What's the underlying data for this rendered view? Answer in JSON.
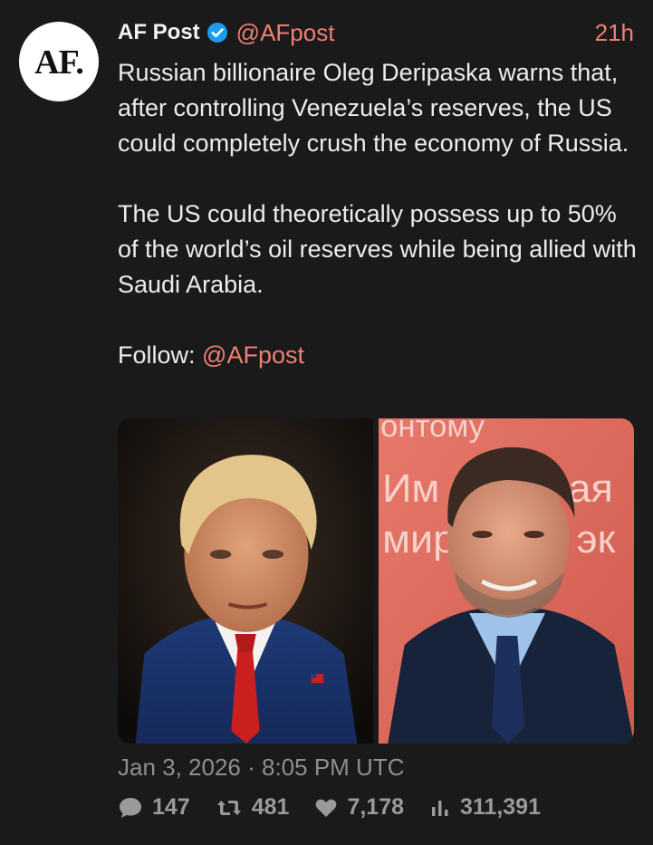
{
  "author": {
    "avatar_text": "AF.",
    "name": "AF Post",
    "handle": "@AFpost",
    "time_ago": "21h"
  },
  "tweet": {
    "paragraph_1": "Russian billionaire Oleg Deripaska warns that, after controlling Venezuela’s reserves, the US could completely crush the economy of Russia.",
    "paragraph_2": "The US could theoretically possess up to 50% of the world’s oil reserves while being allied with Saudi Arabia.",
    "follow_label": "Follow:",
    "follow_handle": "@AFpost"
  },
  "media": {
    "right_photo_backdrop_text": [
      "онтому",
      "Им",
      "ая",
      "мир",
      "эк"
    ]
  },
  "timestamp": "Jan 3, 2026 · 8:05 PM UTC",
  "stats": {
    "replies": "147",
    "retweets": "481",
    "likes": "7,178",
    "views": "311,391"
  },
  "colors": {
    "background": "#1b1a1b",
    "accent": "#f07f73",
    "verified": "#1d9bf0",
    "muted": "#8e8e8e"
  },
  "icons": {
    "verified": "verified-badge-icon",
    "reply": "comment-bubble-icon",
    "retweet": "retweet-icon",
    "like": "heart-icon",
    "views": "bar-chart-icon"
  }
}
